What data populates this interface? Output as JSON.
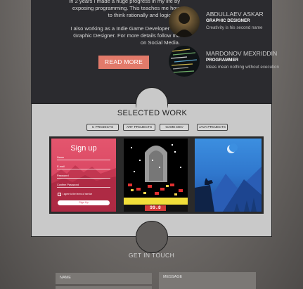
{
  "about": {
    "paragraph1": "In 2 years I made a huge progress in my life by exposing programming. This teaches me how to think rationally and logically.",
    "paragraph2": "I also working as a Indie Game Developer and Graphic Designer. For more details follow me on Social Media.",
    "read_more": "READ MORE"
  },
  "team": [
    {
      "name": "ABDULLAEV ASKAR",
      "role": "GRAPHIC DESIGNER",
      "desc": "Creativity is his second name"
    },
    {
      "name": "MARDONOV MEXRIDDIN",
      "role": "PROGRAMMER",
      "desc": "Ideas mean nothing without execution"
    }
  ],
  "works": {
    "title": "SELECTED WORK",
    "filters": [
      "C PROJECTS",
      "ART PROJECTS",
      "GAME DEV",
      "JAVA PROJECTS"
    ]
  },
  "signup_mock": {
    "heading": "Sign up",
    "fields": [
      "Name",
      "E-mail",
      "Password",
      "Confirm Password"
    ],
    "terms": "I agree to the terms of service",
    "button": "Sign Up"
  },
  "game_mock": {
    "score": "99.8"
  },
  "contact": {
    "title": "GET IN TOUCH",
    "name_placeholder": "NAME",
    "message_placeholder": "MESSAGE"
  },
  "colors": {
    "accent": "#e27a6a",
    "dark_panel": "#2b2b2f",
    "works_bg": "#c9c9c9"
  }
}
